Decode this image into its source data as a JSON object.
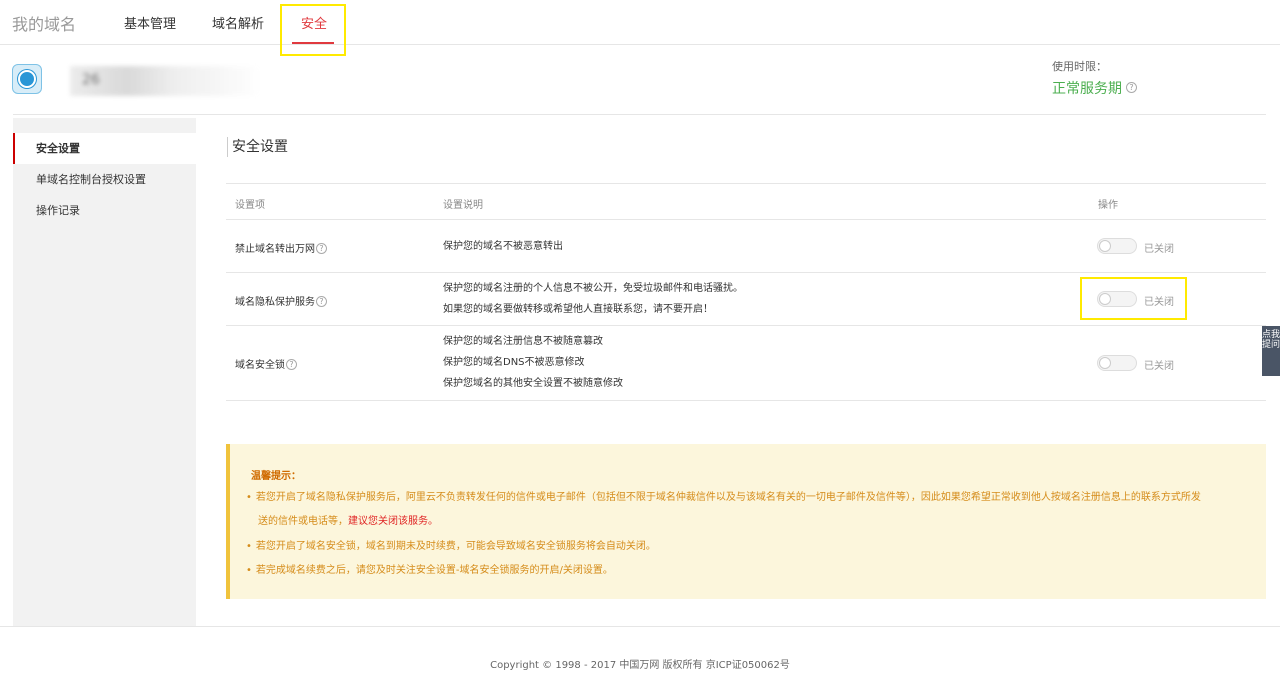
{
  "nav": {
    "brand": "我的域名",
    "tabs": [
      {
        "label": "基本管理"
      },
      {
        "label": "域名解析"
      },
      {
        "label": "安全"
      }
    ]
  },
  "domain": {
    "name_obscured": "26",
    "usage_label": "使用时限：",
    "usage_status": "正常服务期",
    "help_glyph": "?"
  },
  "sidebar": {
    "items": [
      {
        "label": "安全设置"
      },
      {
        "label": "单域名控制台授权设置"
      },
      {
        "label": "操作记录"
      }
    ]
  },
  "section": {
    "title": "安全设置"
  },
  "table": {
    "headers": {
      "item": "设置项",
      "desc": "设置说明",
      "op": "操作"
    },
    "rows": [
      {
        "name": "禁止域名转出万网",
        "desc": [
          "保护您的域名不被恶意转出"
        ],
        "status": "已关闭",
        "on": false
      },
      {
        "name": "域名隐私保护服务",
        "desc": [
          "保护您的域名注册的个人信息不被公开，免受垃圾邮件和电话骚扰。",
          "如果您的域名要做转移或希望他人直接联系您，请不要开启！"
        ],
        "status": "已关闭",
        "on": false
      },
      {
        "name": "域名安全锁",
        "desc": [
          "保护您的域名注册信息不被随意篡改",
          "保护您的域名DNS不被恶意修改",
          "保护您域名的其他安全设置不被随意修改"
        ],
        "status": "已关闭",
        "on": false
      }
    ]
  },
  "notice": {
    "title": "温馨提示：",
    "item1_a": "若您开启了域名隐私保护服务后，阿里云不负责转发任何的信件或电子邮件（包括但不限于域名仲裁信件以及与该域名有关的一切电子邮件及信件等），因此如果您希望正常收到他人按域名注册信息上的联系方式所发",
    "item1_b": "送的信件或电话等，",
    "item1_red": "建议您关闭该服务。",
    "item2": "若您开启了域名安全锁，域名到期未及时续费，可能会导致域名安全锁服务将会自动关闭。",
    "item3": "若完成域名续费之后，请您及时关注安全设置-域名安全锁服务的开启/关闭设置。",
    "bullet": "•"
  },
  "footer": {
    "text": "Copyright © 1998 - 2017 中国万网 版权所有 京ICP证050062号"
  },
  "float_tab": {
    "label": "点我提问"
  },
  "colors": {
    "accent_red": "#e0393e",
    "status_green": "#4caf50",
    "notice_bg": "#fcf6dc",
    "highlight": "#ffea00"
  }
}
